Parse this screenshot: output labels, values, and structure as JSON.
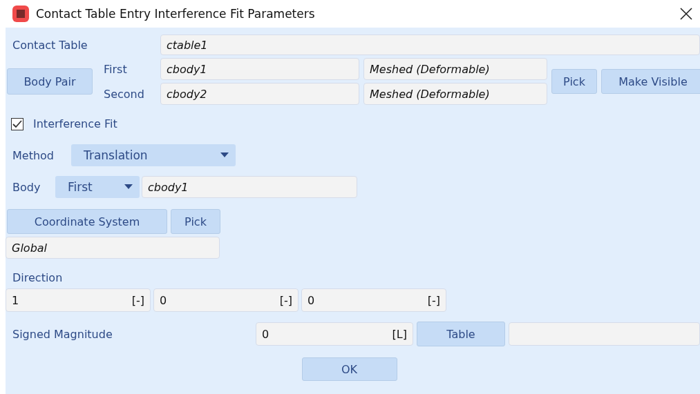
{
  "window": {
    "title": "Contact Table Entry Interference Fit Parameters"
  },
  "contact_table": {
    "label": "Contact Table",
    "value": "ctable1"
  },
  "body_pair": {
    "button": "Body Pair",
    "rows": [
      {
        "label": "First",
        "name": "cbody1",
        "type": "Meshed (Deformable)"
      },
      {
        "label": "Second",
        "name": "cbody2",
        "type": "Meshed (Deformable)"
      }
    ],
    "pick": "Pick",
    "make_visible": "Make Visible"
  },
  "interference_fit": {
    "label": "Interference Fit",
    "checked": true
  },
  "method": {
    "label": "Method",
    "value": "Translation"
  },
  "body": {
    "label": "Body",
    "value": "First",
    "name": "cbody1"
  },
  "coordinate_system": {
    "button": "Coordinate System",
    "pick": "Pick",
    "value": "Global"
  },
  "direction": {
    "label": "Direction",
    "components": [
      {
        "value": "1",
        "unit": "[-]"
      },
      {
        "value": "0",
        "unit": "[-]"
      },
      {
        "value": "0",
        "unit": "[-]"
      }
    ]
  },
  "signed_magnitude": {
    "label": "Signed Magnitude",
    "value": "0",
    "unit": "[L]",
    "table_button": "Table"
  },
  "buttons": [
    "OK"
  ]
}
